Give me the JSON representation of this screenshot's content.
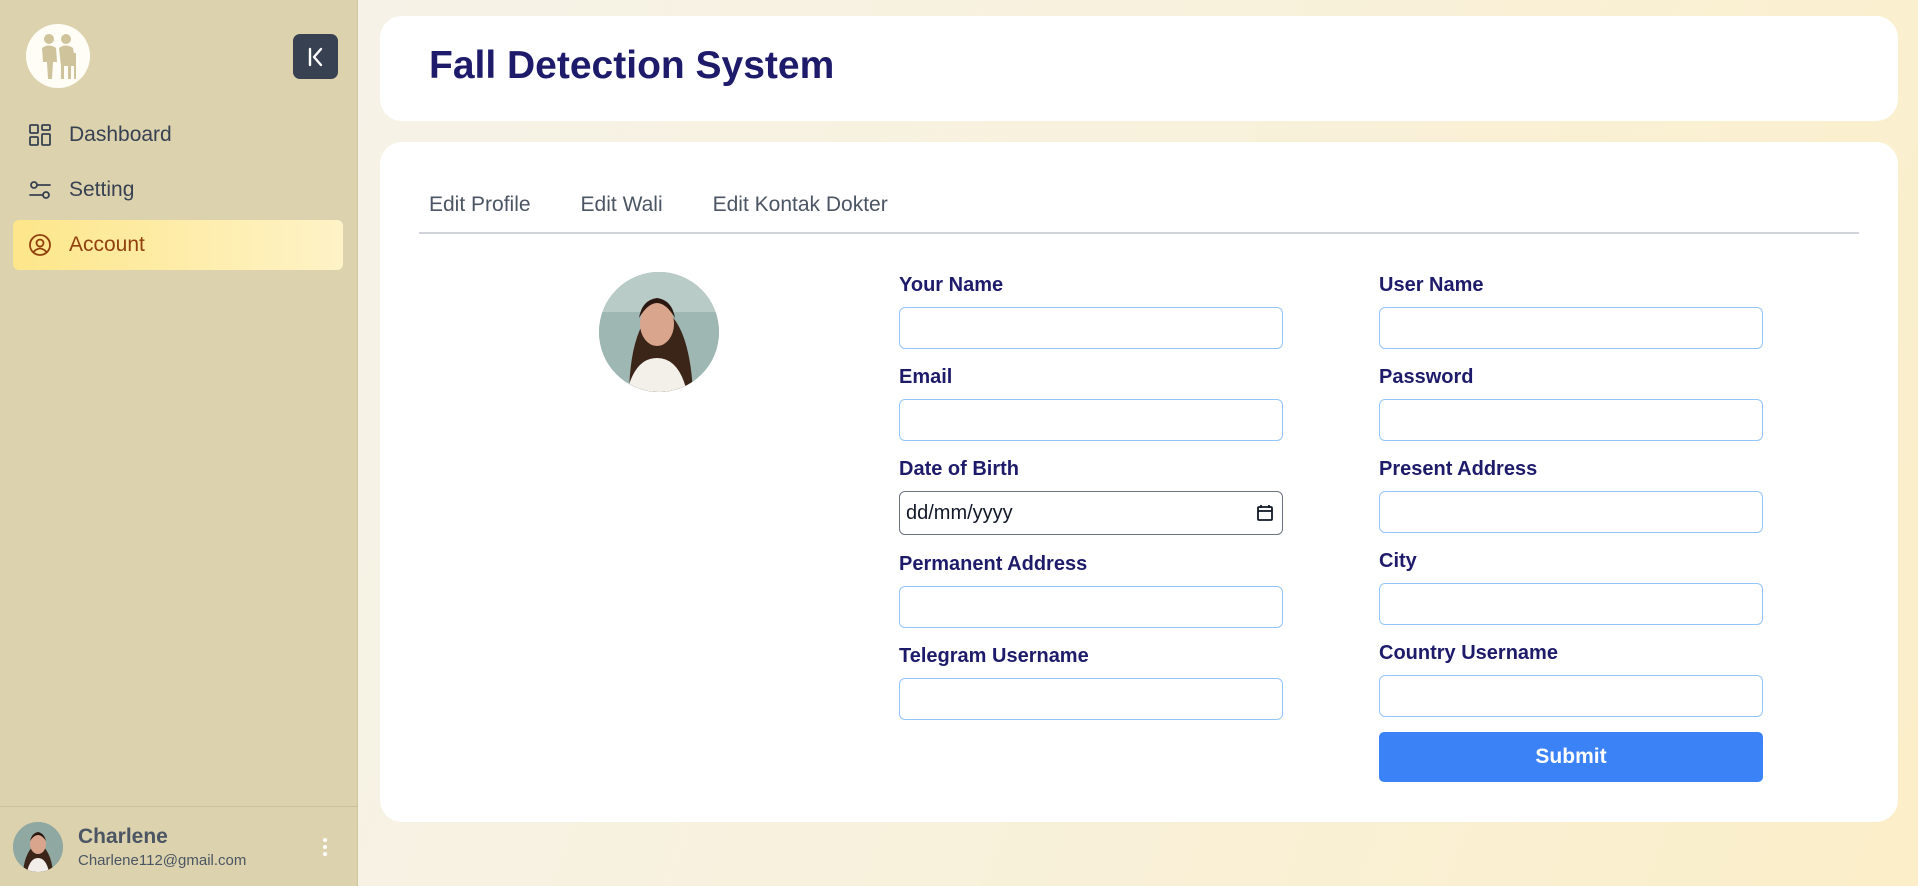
{
  "app": {
    "title": "Fall Detection System"
  },
  "sidebar": {
    "items": [
      {
        "label": "Dashboard",
        "icon": "dashboard-grid-icon"
      },
      {
        "label": "Setting",
        "icon": "sliders-icon"
      },
      {
        "label": "Account",
        "icon": "user-circle-icon",
        "active": true
      }
    ],
    "user": {
      "name": "Charlene",
      "email": "Charlene112@gmail.com"
    }
  },
  "tabs": [
    "Edit Profile",
    "Edit Wali",
    "Edit Kontak Dokter"
  ],
  "form": {
    "left": [
      {
        "label": "Your Name",
        "value": ""
      },
      {
        "label": "Email",
        "value": ""
      },
      {
        "label": "Date of Birth",
        "placeholder": "dd/mm/yyyy"
      },
      {
        "label": "Permanent Address",
        "value": ""
      },
      {
        "label": "Telegram Username",
        "value": ""
      }
    ],
    "right": [
      {
        "label": "User Name",
        "value": ""
      },
      {
        "label": "Password",
        "value": ""
      },
      {
        "label": "Present Address",
        "value": ""
      },
      {
        "label": "City",
        "value": ""
      },
      {
        "label": "Country Username",
        "value": ""
      }
    ],
    "submit_label": "Submit"
  },
  "colors": {
    "accent": "#3b82f6",
    "title": "#1e1b6b",
    "sidebar_bg": "#dcd3ae",
    "active_item": "#fde68a"
  }
}
